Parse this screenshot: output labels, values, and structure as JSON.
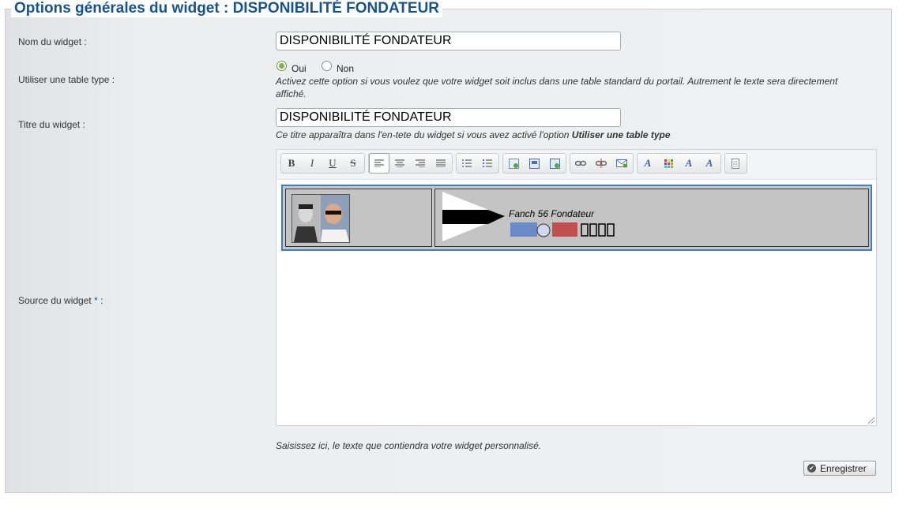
{
  "section": {
    "legend": "Options générales du widget : DISPONIBILITÉ FONDATEUR"
  },
  "fields": {
    "name_label": "Nom du widget :",
    "name_value": "DISPONIBILITÉ FONDATEUR",
    "table_label": "Utiliser une table type :",
    "radio_yes": "Oui",
    "radio_no": "Non",
    "radio_selected": "Oui",
    "table_hint": "Activez cette option si vous voulez que votre widget soit inclus dans une table standard du portail. Autrement le texte sera directement affiché.",
    "title_label": "Titre du widget :",
    "title_value": "DISPONIBILITÉ FONDATEUR",
    "title_hint_prefix": "Ce titre apparaîtra dans l'en-tete du widget si vous avez activé l'option ",
    "title_hint_bold": "Utiliser une table type",
    "source_label": "Source du widget ",
    "source_required": "*",
    "source_label_suffix": " :",
    "source_hint": "Saisissez ici, le texte que contiendra votre widget personnalisé."
  },
  "editor": {
    "toolbar": [
      "bold-icon",
      "italic-icon",
      "underline-icon",
      "strikethrough-icon",
      "align-left-icon",
      "align-center-icon",
      "align-right-icon",
      "align-justify-icon",
      "bullet-list-icon",
      "numbered-list-icon",
      "insert-image-icon",
      "insert-table-icon",
      "insert-media-icon",
      "link-icon",
      "unlink-icon",
      "email-link-icon",
      "font-color-icon",
      "palette-icon",
      "font-style-icon",
      "clear-format-icon",
      "source-icon"
    ],
    "content_text": "Fanch 56  Fondateur"
  },
  "actions": {
    "save_label": "Enregistrer"
  },
  "colors": {
    "title_blue": "#17538f",
    "radio_green": "#7fb24a",
    "table_border_blue": "#3f7fc1"
  }
}
